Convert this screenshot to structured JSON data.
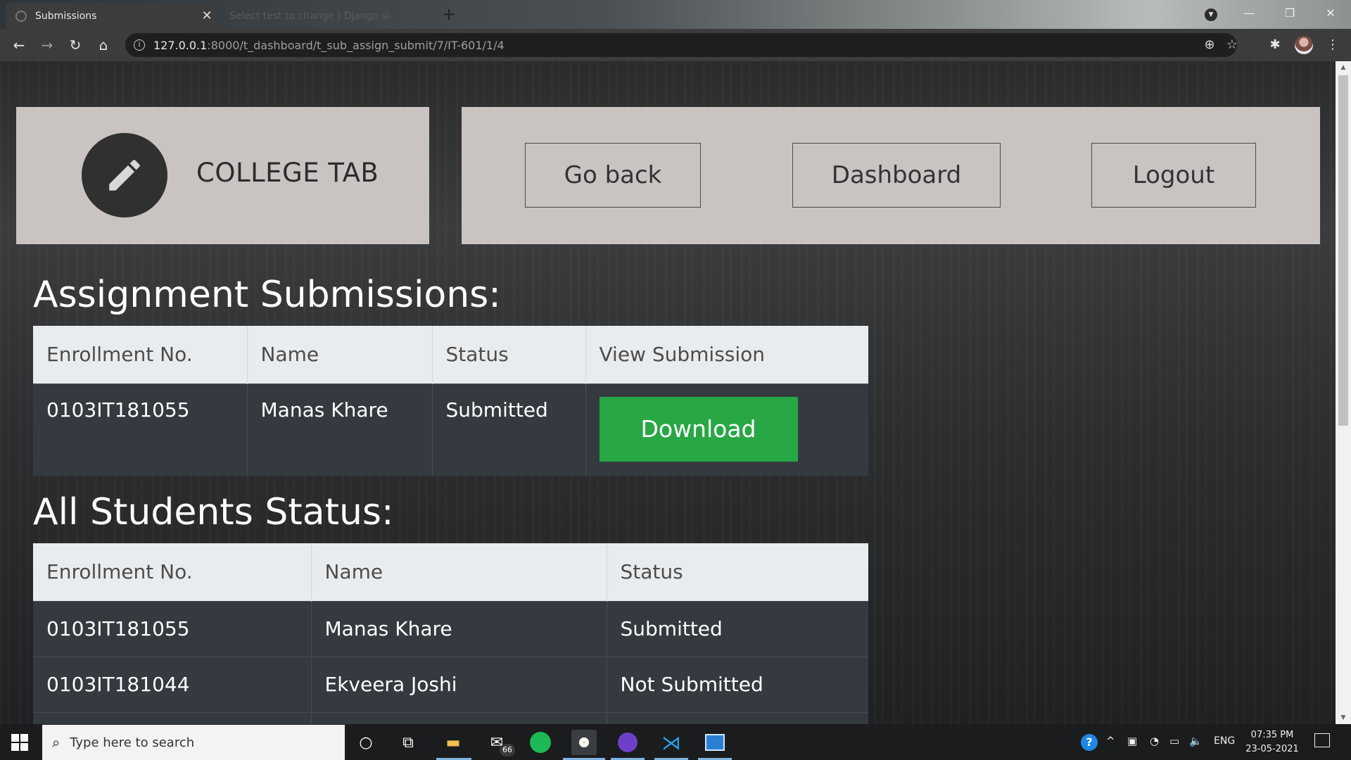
{
  "browser": {
    "tabs": [
      {
        "title": "Submissions",
        "active": true
      },
      {
        "title": "Select test to change | Django si",
        "active": false
      }
    ],
    "url_host": "127.0.0.1",
    "url_path": ":8000/t_dashboard/t_sub_assign_submit/7/IT-601/1/4"
  },
  "brand": {
    "name": "COLLEGE TAB",
    "icon": "pencil-icon"
  },
  "nav": {
    "go_back": "Go back",
    "dashboard": "Dashboard",
    "logout": "Logout"
  },
  "submissions": {
    "heading": "Assignment Submissions:",
    "columns": [
      "Enrollment No.",
      "Name",
      "Status",
      "View Submission"
    ],
    "rows": [
      {
        "enrollment": "0103IT181055",
        "name": "Manas Khare",
        "status": "Submitted",
        "action": "Download"
      }
    ]
  },
  "students": {
    "heading": "All Students Status:",
    "columns": [
      "Enrollment No.",
      "Name",
      "Status"
    ],
    "rows": [
      {
        "enrollment": "0103IT181055",
        "name": "Manas Khare",
        "status": "Submitted"
      },
      {
        "enrollment": "0103IT181044",
        "name": "Ekveera Joshi",
        "status": "Not Submitted"
      }
    ]
  },
  "taskbar": {
    "search_placeholder": "Type here to search",
    "mail_badge": "66",
    "language": "ENG",
    "time": "07:35 PM",
    "date": "23-05-2021"
  },
  "colors": {
    "download_button": "#28a745",
    "panel": "#c9c3c1",
    "table_header": "#e9ecef",
    "table_body": "#343a40"
  }
}
